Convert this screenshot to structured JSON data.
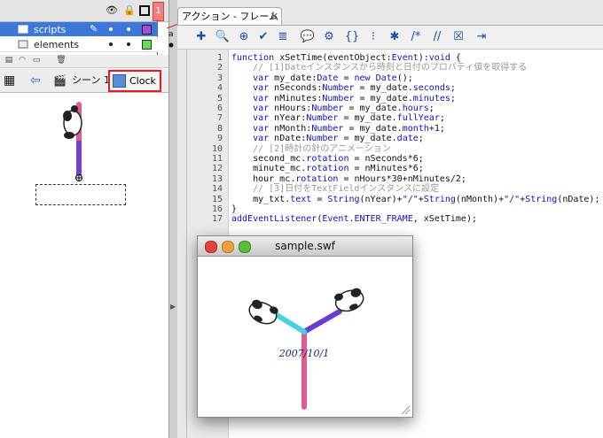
{
  "timeline": {
    "frame_number": "1",
    "layers": [
      {
        "name": "scripts"
      },
      {
        "name": "elements"
      }
    ]
  },
  "scene_bar": {
    "scene_label": "シーン 1",
    "symbol_label": "Clock"
  },
  "actions_panel": {
    "tab_label": "アクション - フレーム",
    "line_numbers": [
      "1",
      "2",
      "3",
      "4",
      "5",
      "6",
      "7",
      "8",
      "9",
      "10",
      "11",
      "12",
      "13",
      "14",
      "15",
      "16",
      "17"
    ]
  },
  "swf_window": {
    "title": "sample.swf",
    "date_text": "2007/10/1"
  },
  "colors": {
    "layer_selected": "#3d78d8",
    "scripts_swatch": "#a64dd8",
    "elements_swatch": "#66dd55",
    "callout_red": "#e02020",
    "hour_hand": "#dc5d8e",
    "minute_hand": "#6a3fd0",
    "second_hand": "#4ccfe0"
  }
}
